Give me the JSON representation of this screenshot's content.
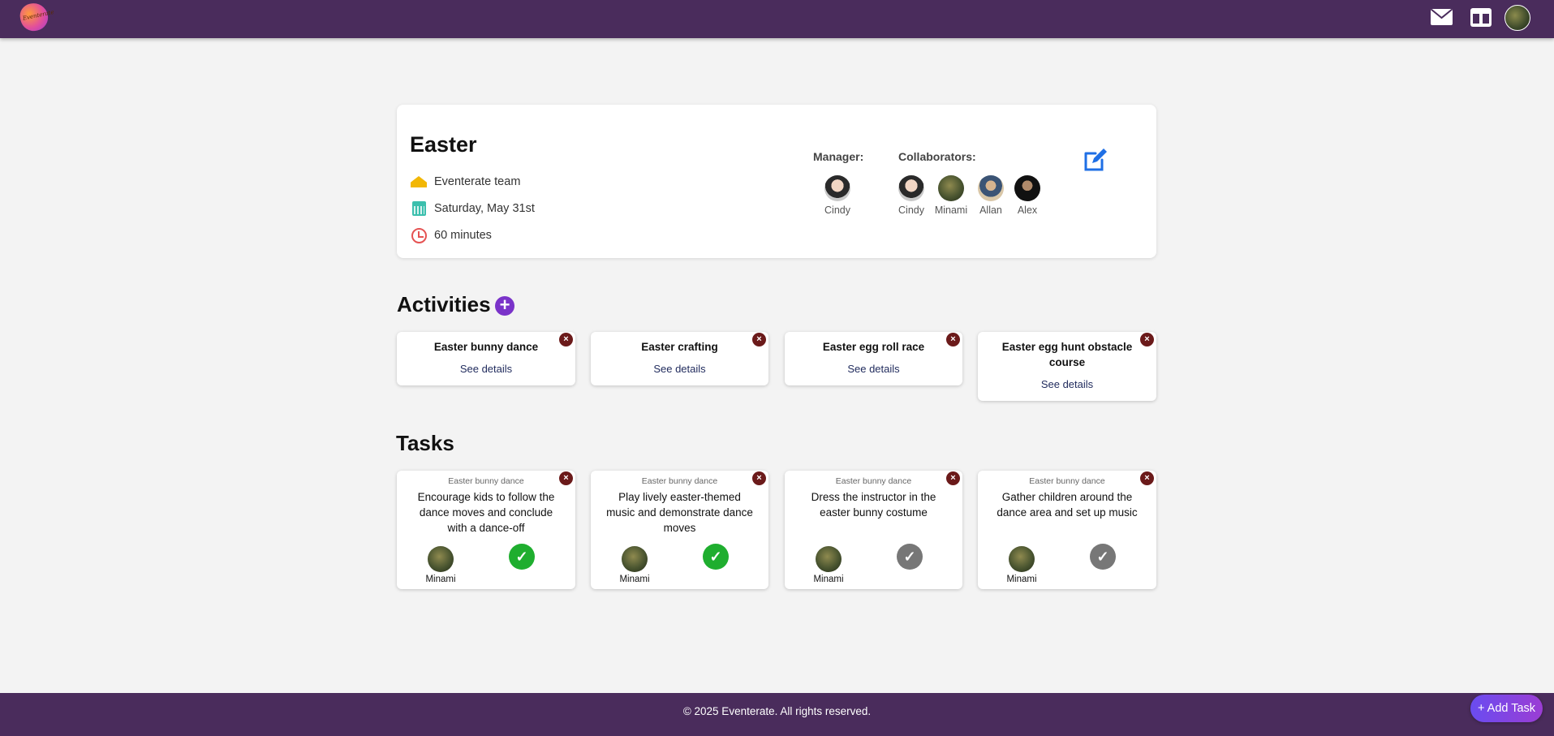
{
  "app": {
    "logo_text": "Eventerate"
  },
  "event": {
    "title": "Easter",
    "team": "Eventerate team",
    "date": "Saturday, May 31st",
    "duration": "60 minutes",
    "manager_label": "Manager:",
    "collaborators_label": "Collaborators:",
    "manager": {
      "name": "Cindy"
    },
    "collaborators": [
      {
        "name": "Cindy"
      },
      {
        "name": "Minami"
      },
      {
        "name": "Allan"
      },
      {
        "name": "Alex"
      }
    ]
  },
  "activities": {
    "title": "Activities",
    "items": [
      {
        "name": "Easter bunny dance",
        "link": "See details"
      },
      {
        "name": "Easter crafting",
        "link": "See details"
      },
      {
        "name": "Easter egg roll race",
        "link": "See details"
      },
      {
        "name": "Easter egg hunt obstacle course",
        "link": "See details"
      }
    ]
  },
  "tasks": {
    "title": "Tasks",
    "items": [
      {
        "activity": "Easter bunny dance",
        "description": "Encourage kids to follow the dance moves and conclude with a dance-off",
        "assignee": "Minami",
        "status": "done"
      },
      {
        "activity": "Easter bunny dance",
        "description": "Play lively easter-themed music and demonstrate dance moves",
        "assignee": "Minami",
        "status": "done"
      },
      {
        "activity": "Easter bunny dance",
        "description": "Dress the instructor in the easter bunny costume",
        "assignee": "Minami",
        "status": "pending"
      },
      {
        "activity": "Easter bunny dance",
        "description": "Gather children around the dance area and set up music",
        "assignee": "Minami",
        "status": "pending"
      }
    ]
  },
  "footer": {
    "copyright": "© 2025 Eventerate. All rights reserved."
  },
  "add_task": {
    "label": "Add Task"
  },
  "colors": {
    "header": "#4a2c5c",
    "accent": "#7a33c9",
    "done": "#1fae2f",
    "pending": "#777777",
    "close": "#6b1a1a",
    "edit": "#1f6fe5"
  },
  "icons": {
    "mail": "envelope-icon",
    "board": "board-icon",
    "edit": "edit-icon",
    "team": "team-icon",
    "calendar": "calendar-icon",
    "clock": "clock-icon",
    "close": "close-icon",
    "check": "check-icon",
    "add": "plus-icon"
  }
}
